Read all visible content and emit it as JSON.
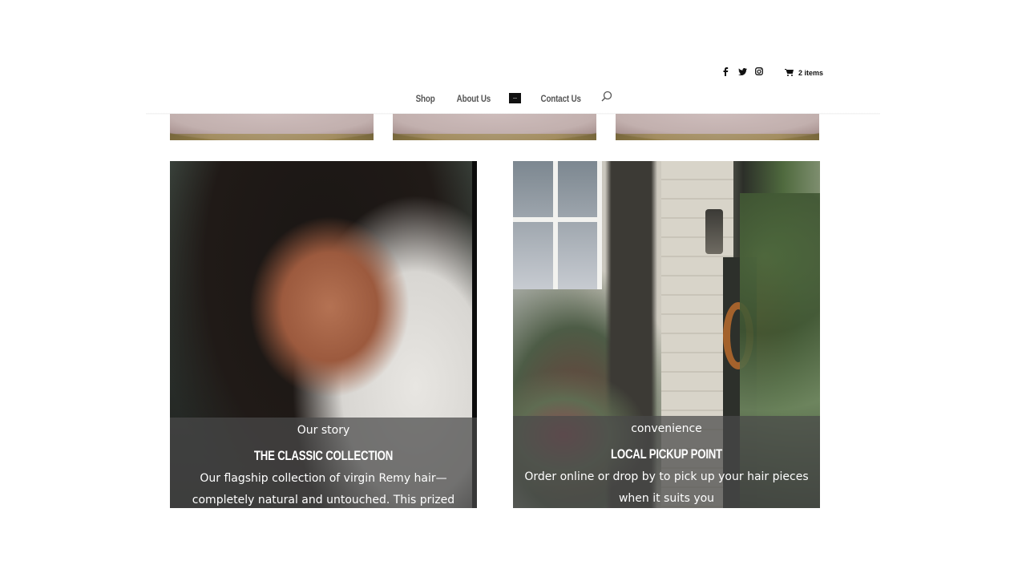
{
  "header": {
    "social": [
      {
        "name": "facebook",
        "glyph": "f"
      },
      {
        "name": "twitter",
        "glyph": "t"
      },
      {
        "name": "instagram",
        "glyph": "ig"
      }
    ],
    "cart_count": "2 items",
    "nav": [
      "Shop",
      "About Us",
      "Contact Us"
    ],
    "search_icon": "search-icon"
  },
  "top_strip": {
    "items": [
      "product-image-1",
      "product-image-2",
      "product-image-3"
    ]
  },
  "cards": [
    {
      "eyebrow": "Our story",
      "title": "THE CLASSIC COLLECTION",
      "description": "Our flagship collection of virgin Remy hair—completely natural and untouched. This prized collection consists of"
    },
    {
      "eyebrow": "convenience",
      "title": "LOCAL PICKUP POINT",
      "description": "Order online or drop by to pick up your hair pieces when it suits you"
    }
  ]
}
